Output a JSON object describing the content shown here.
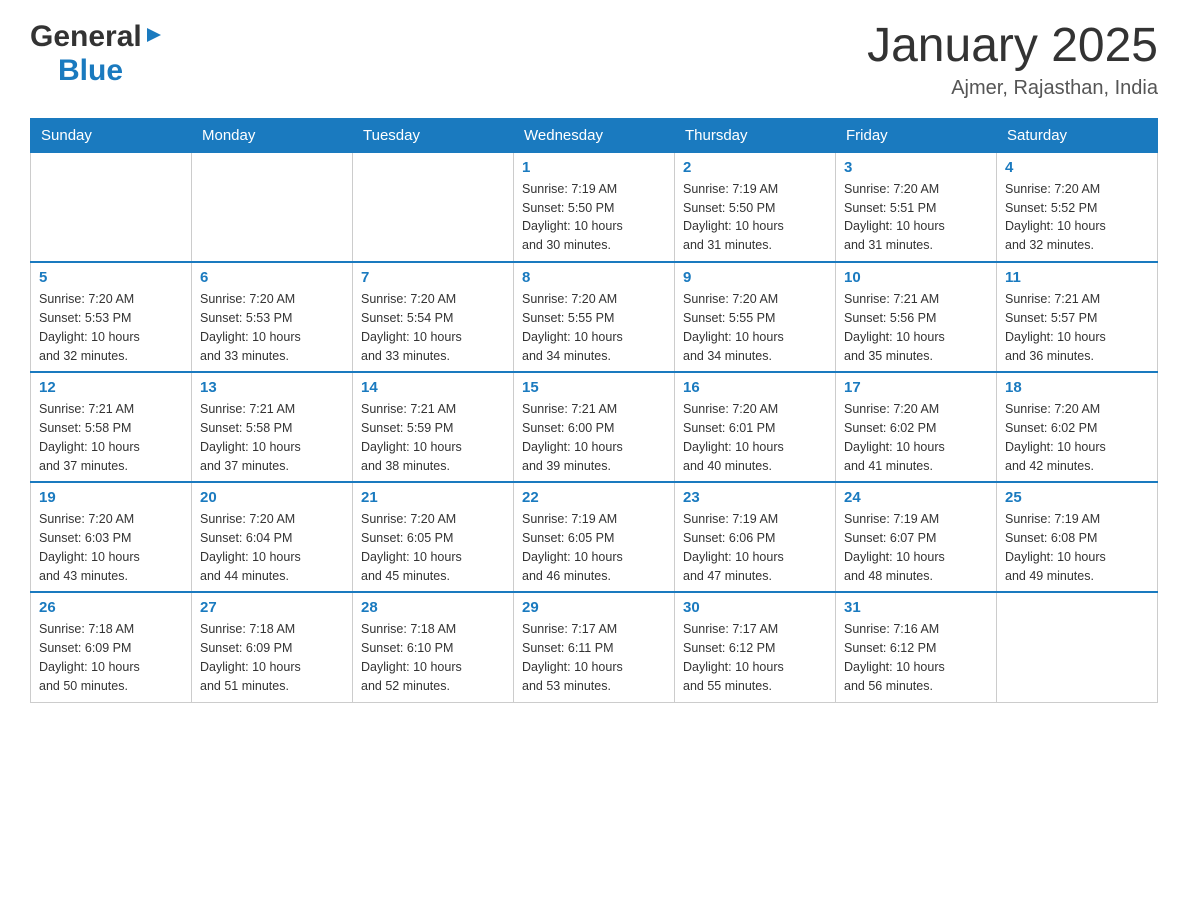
{
  "header": {
    "logo_general": "General",
    "logo_blue": "Blue",
    "month_title": "January 2025",
    "location": "Ajmer, Rajasthan, India"
  },
  "calendar": {
    "days_of_week": [
      "Sunday",
      "Monday",
      "Tuesday",
      "Wednesday",
      "Thursday",
      "Friday",
      "Saturday"
    ],
    "weeks": [
      [
        {
          "day": "",
          "info": ""
        },
        {
          "day": "",
          "info": ""
        },
        {
          "day": "",
          "info": ""
        },
        {
          "day": "1",
          "info": "Sunrise: 7:19 AM\nSunset: 5:50 PM\nDaylight: 10 hours\nand 30 minutes."
        },
        {
          "day": "2",
          "info": "Sunrise: 7:19 AM\nSunset: 5:50 PM\nDaylight: 10 hours\nand 31 minutes."
        },
        {
          "day": "3",
          "info": "Sunrise: 7:20 AM\nSunset: 5:51 PM\nDaylight: 10 hours\nand 31 minutes."
        },
        {
          "day": "4",
          "info": "Sunrise: 7:20 AM\nSunset: 5:52 PM\nDaylight: 10 hours\nand 32 minutes."
        }
      ],
      [
        {
          "day": "5",
          "info": "Sunrise: 7:20 AM\nSunset: 5:53 PM\nDaylight: 10 hours\nand 32 minutes."
        },
        {
          "day": "6",
          "info": "Sunrise: 7:20 AM\nSunset: 5:53 PM\nDaylight: 10 hours\nand 33 minutes."
        },
        {
          "day": "7",
          "info": "Sunrise: 7:20 AM\nSunset: 5:54 PM\nDaylight: 10 hours\nand 33 minutes."
        },
        {
          "day": "8",
          "info": "Sunrise: 7:20 AM\nSunset: 5:55 PM\nDaylight: 10 hours\nand 34 minutes."
        },
        {
          "day": "9",
          "info": "Sunrise: 7:20 AM\nSunset: 5:55 PM\nDaylight: 10 hours\nand 34 minutes."
        },
        {
          "day": "10",
          "info": "Sunrise: 7:21 AM\nSunset: 5:56 PM\nDaylight: 10 hours\nand 35 minutes."
        },
        {
          "day": "11",
          "info": "Sunrise: 7:21 AM\nSunset: 5:57 PM\nDaylight: 10 hours\nand 36 minutes."
        }
      ],
      [
        {
          "day": "12",
          "info": "Sunrise: 7:21 AM\nSunset: 5:58 PM\nDaylight: 10 hours\nand 37 minutes."
        },
        {
          "day": "13",
          "info": "Sunrise: 7:21 AM\nSunset: 5:58 PM\nDaylight: 10 hours\nand 37 minutes."
        },
        {
          "day": "14",
          "info": "Sunrise: 7:21 AM\nSunset: 5:59 PM\nDaylight: 10 hours\nand 38 minutes."
        },
        {
          "day": "15",
          "info": "Sunrise: 7:21 AM\nSunset: 6:00 PM\nDaylight: 10 hours\nand 39 minutes."
        },
        {
          "day": "16",
          "info": "Sunrise: 7:20 AM\nSunset: 6:01 PM\nDaylight: 10 hours\nand 40 minutes."
        },
        {
          "day": "17",
          "info": "Sunrise: 7:20 AM\nSunset: 6:02 PM\nDaylight: 10 hours\nand 41 minutes."
        },
        {
          "day": "18",
          "info": "Sunrise: 7:20 AM\nSunset: 6:02 PM\nDaylight: 10 hours\nand 42 minutes."
        }
      ],
      [
        {
          "day": "19",
          "info": "Sunrise: 7:20 AM\nSunset: 6:03 PM\nDaylight: 10 hours\nand 43 minutes."
        },
        {
          "day": "20",
          "info": "Sunrise: 7:20 AM\nSunset: 6:04 PM\nDaylight: 10 hours\nand 44 minutes."
        },
        {
          "day": "21",
          "info": "Sunrise: 7:20 AM\nSunset: 6:05 PM\nDaylight: 10 hours\nand 45 minutes."
        },
        {
          "day": "22",
          "info": "Sunrise: 7:19 AM\nSunset: 6:05 PM\nDaylight: 10 hours\nand 46 minutes."
        },
        {
          "day": "23",
          "info": "Sunrise: 7:19 AM\nSunset: 6:06 PM\nDaylight: 10 hours\nand 47 minutes."
        },
        {
          "day": "24",
          "info": "Sunrise: 7:19 AM\nSunset: 6:07 PM\nDaylight: 10 hours\nand 48 minutes."
        },
        {
          "day": "25",
          "info": "Sunrise: 7:19 AM\nSunset: 6:08 PM\nDaylight: 10 hours\nand 49 minutes."
        }
      ],
      [
        {
          "day": "26",
          "info": "Sunrise: 7:18 AM\nSunset: 6:09 PM\nDaylight: 10 hours\nand 50 minutes."
        },
        {
          "day": "27",
          "info": "Sunrise: 7:18 AM\nSunset: 6:09 PM\nDaylight: 10 hours\nand 51 minutes."
        },
        {
          "day": "28",
          "info": "Sunrise: 7:18 AM\nSunset: 6:10 PM\nDaylight: 10 hours\nand 52 minutes."
        },
        {
          "day": "29",
          "info": "Sunrise: 7:17 AM\nSunset: 6:11 PM\nDaylight: 10 hours\nand 53 minutes."
        },
        {
          "day": "30",
          "info": "Sunrise: 7:17 AM\nSunset: 6:12 PM\nDaylight: 10 hours\nand 55 minutes."
        },
        {
          "day": "31",
          "info": "Sunrise: 7:16 AM\nSunset: 6:12 PM\nDaylight: 10 hours\nand 56 minutes."
        },
        {
          "day": "",
          "info": ""
        }
      ]
    ]
  }
}
